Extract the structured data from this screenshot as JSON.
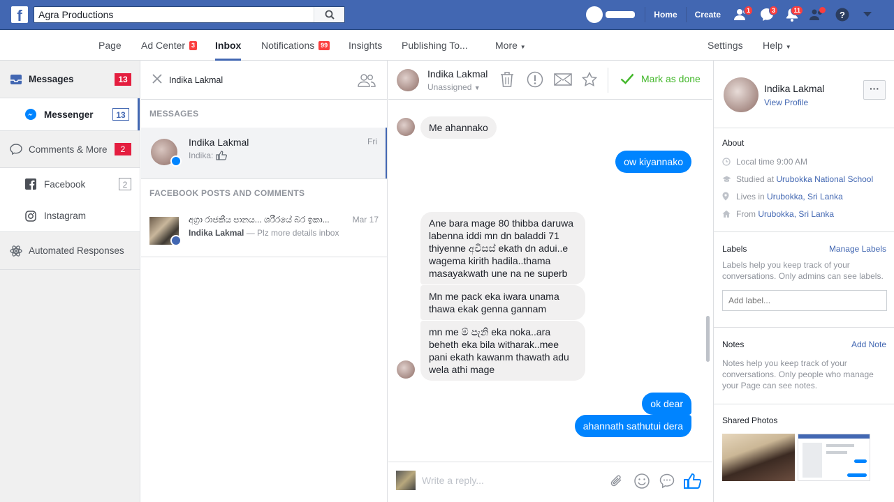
{
  "topbar": {
    "search_value": "Agra Productions",
    "home_label": "Home",
    "create_label": "Create",
    "friends_badge": "1",
    "messages_badge": "3",
    "notifications_badge": "11"
  },
  "pagenav": {
    "page_label": "Page",
    "ad_center_label": "Ad Center",
    "ad_center_badge": "3",
    "inbox_label": "Inbox",
    "notifications_label": "Notifications",
    "notifications_badge": "99",
    "insights_label": "Insights",
    "publishing_label": "Publishing To...",
    "more_label": "More",
    "settings_label": "Settings",
    "help_label": "Help"
  },
  "sidebar": {
    "items": [
      {
        "label": "Messages",
        "count": "13"
      },
      {
        "label": "Messenger",
        "count": "13"
      },
      {
        "label": "Comments & More",
        "count": "2"
      },
      {
        "label": "Facebook",
        "count": "2"
      },
      {
        "label": "Instagram",
        "count": ""
      },
      {
        "label": "Automated Responses",
        "count": ""
      }
    ]
  },
  "convlist": {
    "search_value": "Indika Lakmal",
    "messages_section": "MESSAGES",
    "conversation": {
      "name": "Indika Lakmal",
      "snippet": "Indika:",
      "date": "Fri"
    },
    "posts_section": "FACEBOOK POSTS AND COMMENTS",
    "post": {
      "title": "අග්‍රා රාජකීය පානය... ශරීරයේ බර ඉකා...",
      "author": "Indika Lakmal",
      "snippet": "— Plz more details inbox",
      "date": "Mar 17"
    }
  },
  "chat": {
    "name": "Indika Lakmal",
    "assigned": "Unassigned",
    "mark_done": "Mark as done",
    "messages": [
      {
        "dir": "in",
        "text": "Me ahannako"
      },
      {
        "dir": "out",
        "text": "ow kiyannako"
      },
      {
        "dir": "in",
        "text": "Ane bara mage 80 thibba daruwa labenna iddi mn dn baladdi 71 thiyenne  අවිසස් ekath dn adui..e wagema kirith hadila..thama masayakwath une na ne superb"
      },
      {
        "dir": "in",
        "text": "Mn me pack eka iwara unama thawa ekak genna gannam"
      },
      {
        "dir": "in",
        "text": "mn me ම් පැනි eka noka..ara beheth eka bila witharak..mee pani ekath kawanm thawath adu wela athi mage"
      },
      {
        "dir": "out",
        "text": "ok dear"
      },
      {
        "dir": "out",
        "text": "ahannath sathutui dera"
      }
    ],
    "reply_placeholder": "Write a reply..."
  },
  "info": {
    "name": "Indika Lakmal",
    "view_profile": "View Profile",
    "about_title": "About",
    "local_time": "Local time 9:00 AM",
    "studied_prefix": "Studied at",
    "studied_link": "Urubokka National School",
    "lives_prefix": "Lives in",
    "lives_link": "Urubokka, Sri Lanka",
    "from_prefix": "From",
    "from_link": "Urubokka, Sri Lanka",
    "labels_title": "Labels",
    "manage_labels": "Manage Labels",
    "labels_help": "Labels help you keep track of your conversations. Only admins can see labels.",
    "add_label_placeholder": "Add label...",
    "notes_title": "Notes",
    "add_note": "Add Note",
    "notes_help": "Notes help you keep track of your conversations. Only people who manage your Page can see notes.",
    "shared_photos_title": "Shared Photos"
  },
  "colors": {
    "facebook_blue": "#4267b2",
    "messenger_blue": "#0084ff",
    "badge_red": "#fa3e3e",
    "done_green": "#42b72a"
  }
}
